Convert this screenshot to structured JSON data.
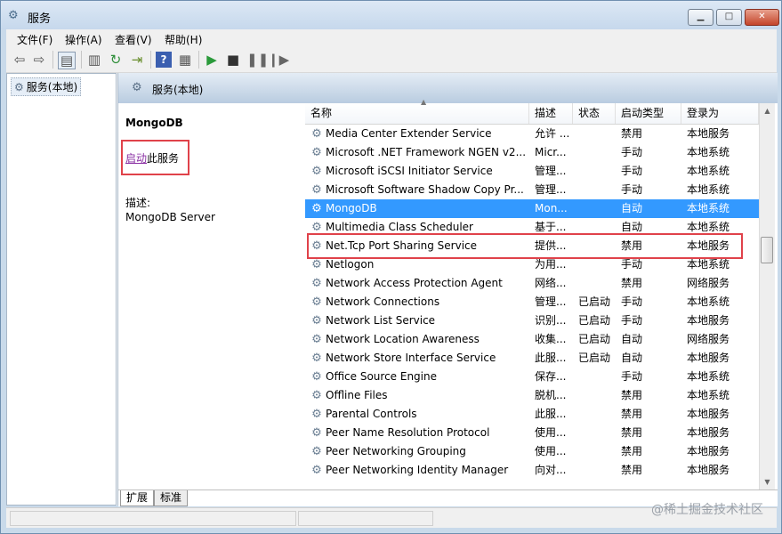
{
  "window": {
    "title": "服务"
  },
  "menu": [
    "文件(F)",
    "操作(A)",
    "查看(V)",
    "帮助(H)"
  ],
  "toolbar": {
    "icons": [
      "back-icon",
      "forward-icon",
      "console-tree-icon",
      "properties-icon",
      "refresh-icon",
      "export-icon",
      "help-icon",
      "view-icon",
      "play-icon",
      "stop-icon",
      "pause-icon",
      "resume-icon"
    ]
  },
  "tree": {
    "root": "服务(本地)"
  },
  "pane": {
    "title": "服务(本地)"
  },
  "detail": {
    "service_name": "MongoDB",
    "start_link": "启动",
    "start_suffix": "此服务",
    "desc_label": "描述:",
    "desc_text": "MongoDB Server"
  },
  "columns": {
    "name": "名称",
    "desc": "描述",
    "status": "状态",
    "startup": "启动类型",
    "logon": "登录为"
  },
  "rows": [
    {
      "name": "Media Center Extender Service",
      "desc": "允许 ...",
      "status": "",
      "startup": "禁用",
      "logon": "本地服务"
    },
    {
      "name": "Microsoft .NET Framework NGEN v2...",
      "desc": "Micr...",
      "status": "",
      "startup": "手动",
      "logon": "本地系统"
    },
    {
      "name": "Microsoft iSCSI Initiator Service",
      "desc": "管理...",
      "status": "",
      "startup": "手动",
      "logon": "本地系统"
    },
    {
      "name": "Microsoft Software Shadow Copy Pr...",
      "desc": "管理...",
      "status": "",
      "startup": "手动",
      "logon": "本地系统"
    },
    {
      "name": "MongoDB",
      "desc": "Mon...",
      "status": "",
      "startup": "自动",
      "logon": "本地系统",
      "selected": true
    },
    {
      "name": "Multimedia Class Scheduler",
      "desc": "基于...",
      "status": "",
      "startup": "自动",
      "logon": "本地系统"
    },
    {
      "name": "Net.Tcp Port Sharing Service",
      "desc": "提供...",
      "status": "",
      "startup": "禁用",
      "logon": "本地服务"
    },
    {
      "name": "Netlogon",
      "desc": "为用...",
      "status": "",
      "startup": "手动",
      "logon": "本地系统"
    },
    {
      "name": "Network Access Protection Agent",
      "desc": "网络...",
      "status": "",
      "startup": "禁用",
      "logon": "网络服务"
    },
    {
      "name": "Network Connections",
      "desc": "管理...",
      "status": "已启动",
      "startup": "手动",
      "logon": "本地系统"
    },
    {
      "name": "Network List Service",
      "desc": "识别...",
      "status": "已启动",
      "startup": "手动",
      "logon": "本地服务"
    },
    {
      "name": "Network Location Awareness",
      "desc": "收集...",
      "status": "已启动",
      "startup": "自动",
      "logon": "网络服务"
    },
    {
      "name": "Network Store Interface Service",
      "desc": "此服...",
      "status": "已启动",
      "startup": "自动",
      "logon": "本地服务"
    },
    {
      "name": "Office Source Engine",
      "desc": "保存...",
      "status": "",
      "startup": "手动",
      "logon": "本地系统"
    },
    {
      "name": "Offline Files",
      "desc": "脱机...",
      "status": "",
      "startup": "禁用",
      "logon": "本地系统"
    },
    {
      "name": "Parental Controls",
      "desc": "此服...",
      "status": "",
      "startup": "禁用",
      "logon": "本地服务"
    },
    {
      "name": "Peer Name Resolution Protocol",
      "desc": "使用...",
      "status": "",
      "startup": "禁用",
      "logon": "本地服务"
    },
    {
      "name": "Peer Networking Grouping",
      "desc": "使用...",
      "status": "",
      "startup": "禁用",
      "logon": "本地服务"
    },
    {
      "name": "Peer Networking Identity Manager",
      "desc": "向对...",
      "status": "",
      "startup": "禁用",
      "logon": "本地服务"
    }
  ],
  "tabs": [
    "扩展",
    "标准"
  ],
  "watermark": "@稀土掘金技术社区"
}
